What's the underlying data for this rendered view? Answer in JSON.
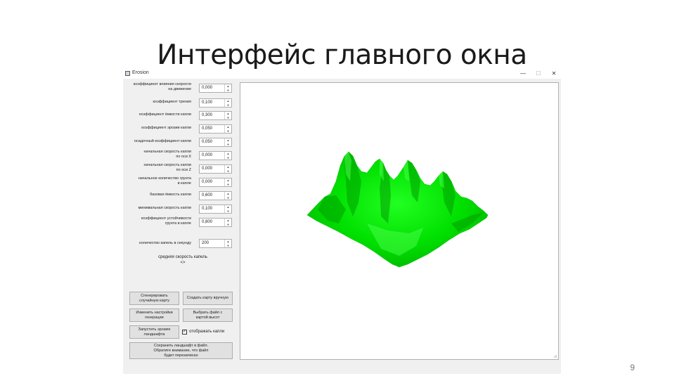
{
  "slide": {
    "title": "Интерфейс главного окна",
    "number": "9"
  },
  "window": {
    "title": "Erosion",
    "controls": {
      "minimize": "—",
      "maximize": "☐",
      "close": "✕"
    }
  },
  "params": [
    {
      "label_line1": "коэффициент влияния скорости",
      "label_line2": "на движение",
      "value": "0,000"
    },
    {
      "label_line1": "коэффициент трения",
      "label_line2": "",
      "value": "0,100"
    },
    {
      "label_line1": "коэффициент ёмкости капли",
      "label_line2": "",
      "value": "0,300"
    },
    {
      "label_line1": "коэффициент эрозии капли",
      "label_line2": "",
      "value": "0,050"
    },
    {
      "label_line1": "осадочный коэффициент капли",
      "label_line2": "",
      "value": "0,050"
    },
    {
      "label_line1": "начальная скорость капли",
      "label_line2": "по оси X",
      "value": "0,000"
    },
    {
      "label_line1": "начальная скорость капли",
      "label_line2": "по оси Z",
      "value": "0,000"
    },
    {
      "label_line1": "начальное количество грунта",
      "label_line2": "в капле",
      "value": "0,000"
    },
    {
      "label_line1": "базовая ёмкость капли",
      "label_line2": "",
      "value": "0,600"
    },
    {
      "label_line1": "минимальная скорость капли",
      "label_line2": "",
      "value": "0,100"
    },
    {
      "label_line1": "коэффициент устойчивости",
      "label_line2": "грунта в капле",
      "value": "0,800"
    }
  ],
  "drops_per_second": {
    "label": "количество капель в секунду",
    "value": "200"
  },
  "avg_speed": {
    "label": "средняя скорость капель",
    "value": "<>"
  },
  "buttons": {
    "generate_line1": "Сгенерировать",
    "generate_line2": "случайную карту",
    "manual": "Создать карту вручную",
    "settings_line1": "Изменить настройки",
    "settings_line2": "генерации",
    "heightmap_line1": "Выбрать файл с",
    "heightmap_line2": "картой высот",
    "erosion_line1": "Запустить эрозию",
    "erosion_line2": "ландшафта",
    "save_line1": "Сохранить ландшафт в файл.",
    "save_line2": "Обратите внимание, что файл",
    "save_line3": "будет перезаписан"
  },
  "show_drops": {
    "label": "отображать капли",
    "checked": true,
    "mark": "✓"
  },
  "terrain": {
    "color": "#00e600",
    "dark": "#00a800"
  },
  "icons": {
    "spin_up": "▲",
    "spin_down": "▼"
  }
}
